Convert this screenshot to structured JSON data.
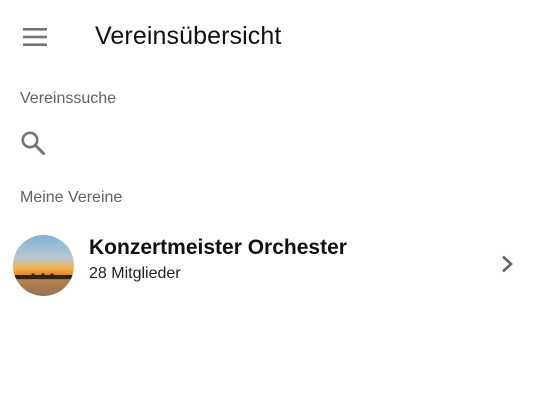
{
  "app_bar": {
    "title": "Vereinsübersicht",
    "menu_icon": "menu-icon"
  },
  "search": {
    "section_label": "Vereinssuche",
    "icon": "search-icon"
  },
  "my_clubs": {
    "section_label": "Meine Vereine",
    "items": [
      {
        "name": "Konzertmeister Orchester",
        "members": "28 Mitglieder",
        "avatar": "sunset-avatar",
        "trailing_icon": "chevron-right-icon"
      }
    ]
  },
  "colors": {
    "background": "#ffffff",
    "icon": "#757575",
    "label": "#5f6368",
    "text": "#111111"
  }
}
